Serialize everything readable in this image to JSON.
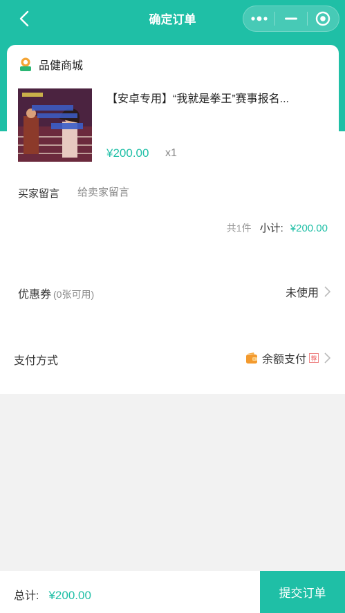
{
  "nav": {
    "title": "确定订单",
    "back_icon": "chevron-left-icon",
    "more_icon": "more-dots-icon",
    "minimize_icon": "minimize-icon",
    "close_icon": "target-circle-icon"
  },
  "theme": {
    "accent": "#1fbfa6",
    "background": "#f2f2f2"
  },
  "shop": {
    "name": "品健商城",
    "logo_icon": "shop-logo-icon"
  },
  "product": {
    "title": "【安卓专用】“我就是拳王”赛事报名...",
    "price": "¥200.00",
    "quantity": "x1",
    "image_icon": "product-image"
  },
  "message": {
    "label": "买家留言",
    "placeholder": "给卖家留言",
    "value": ""
  },
  "summary": {
    "count": "共1件",
    "subtotal_label": "小计:",
    "subtotal_value": "¥200.00"
  },
  "coupon": {
    "label": "优惠券",
    "available": "(0张可用)",
    "status": "未使用"
  },
  "payment": {
    "label": "支付方式",
    "method": "余额支付",
    "icon": "wallet-icon",
    "tag": "荐"
  },
  "footer": {
    "total_label": "总计:",
    "total_value": "¥200.00",
    "submit_label": "提交订单"
  }
}
